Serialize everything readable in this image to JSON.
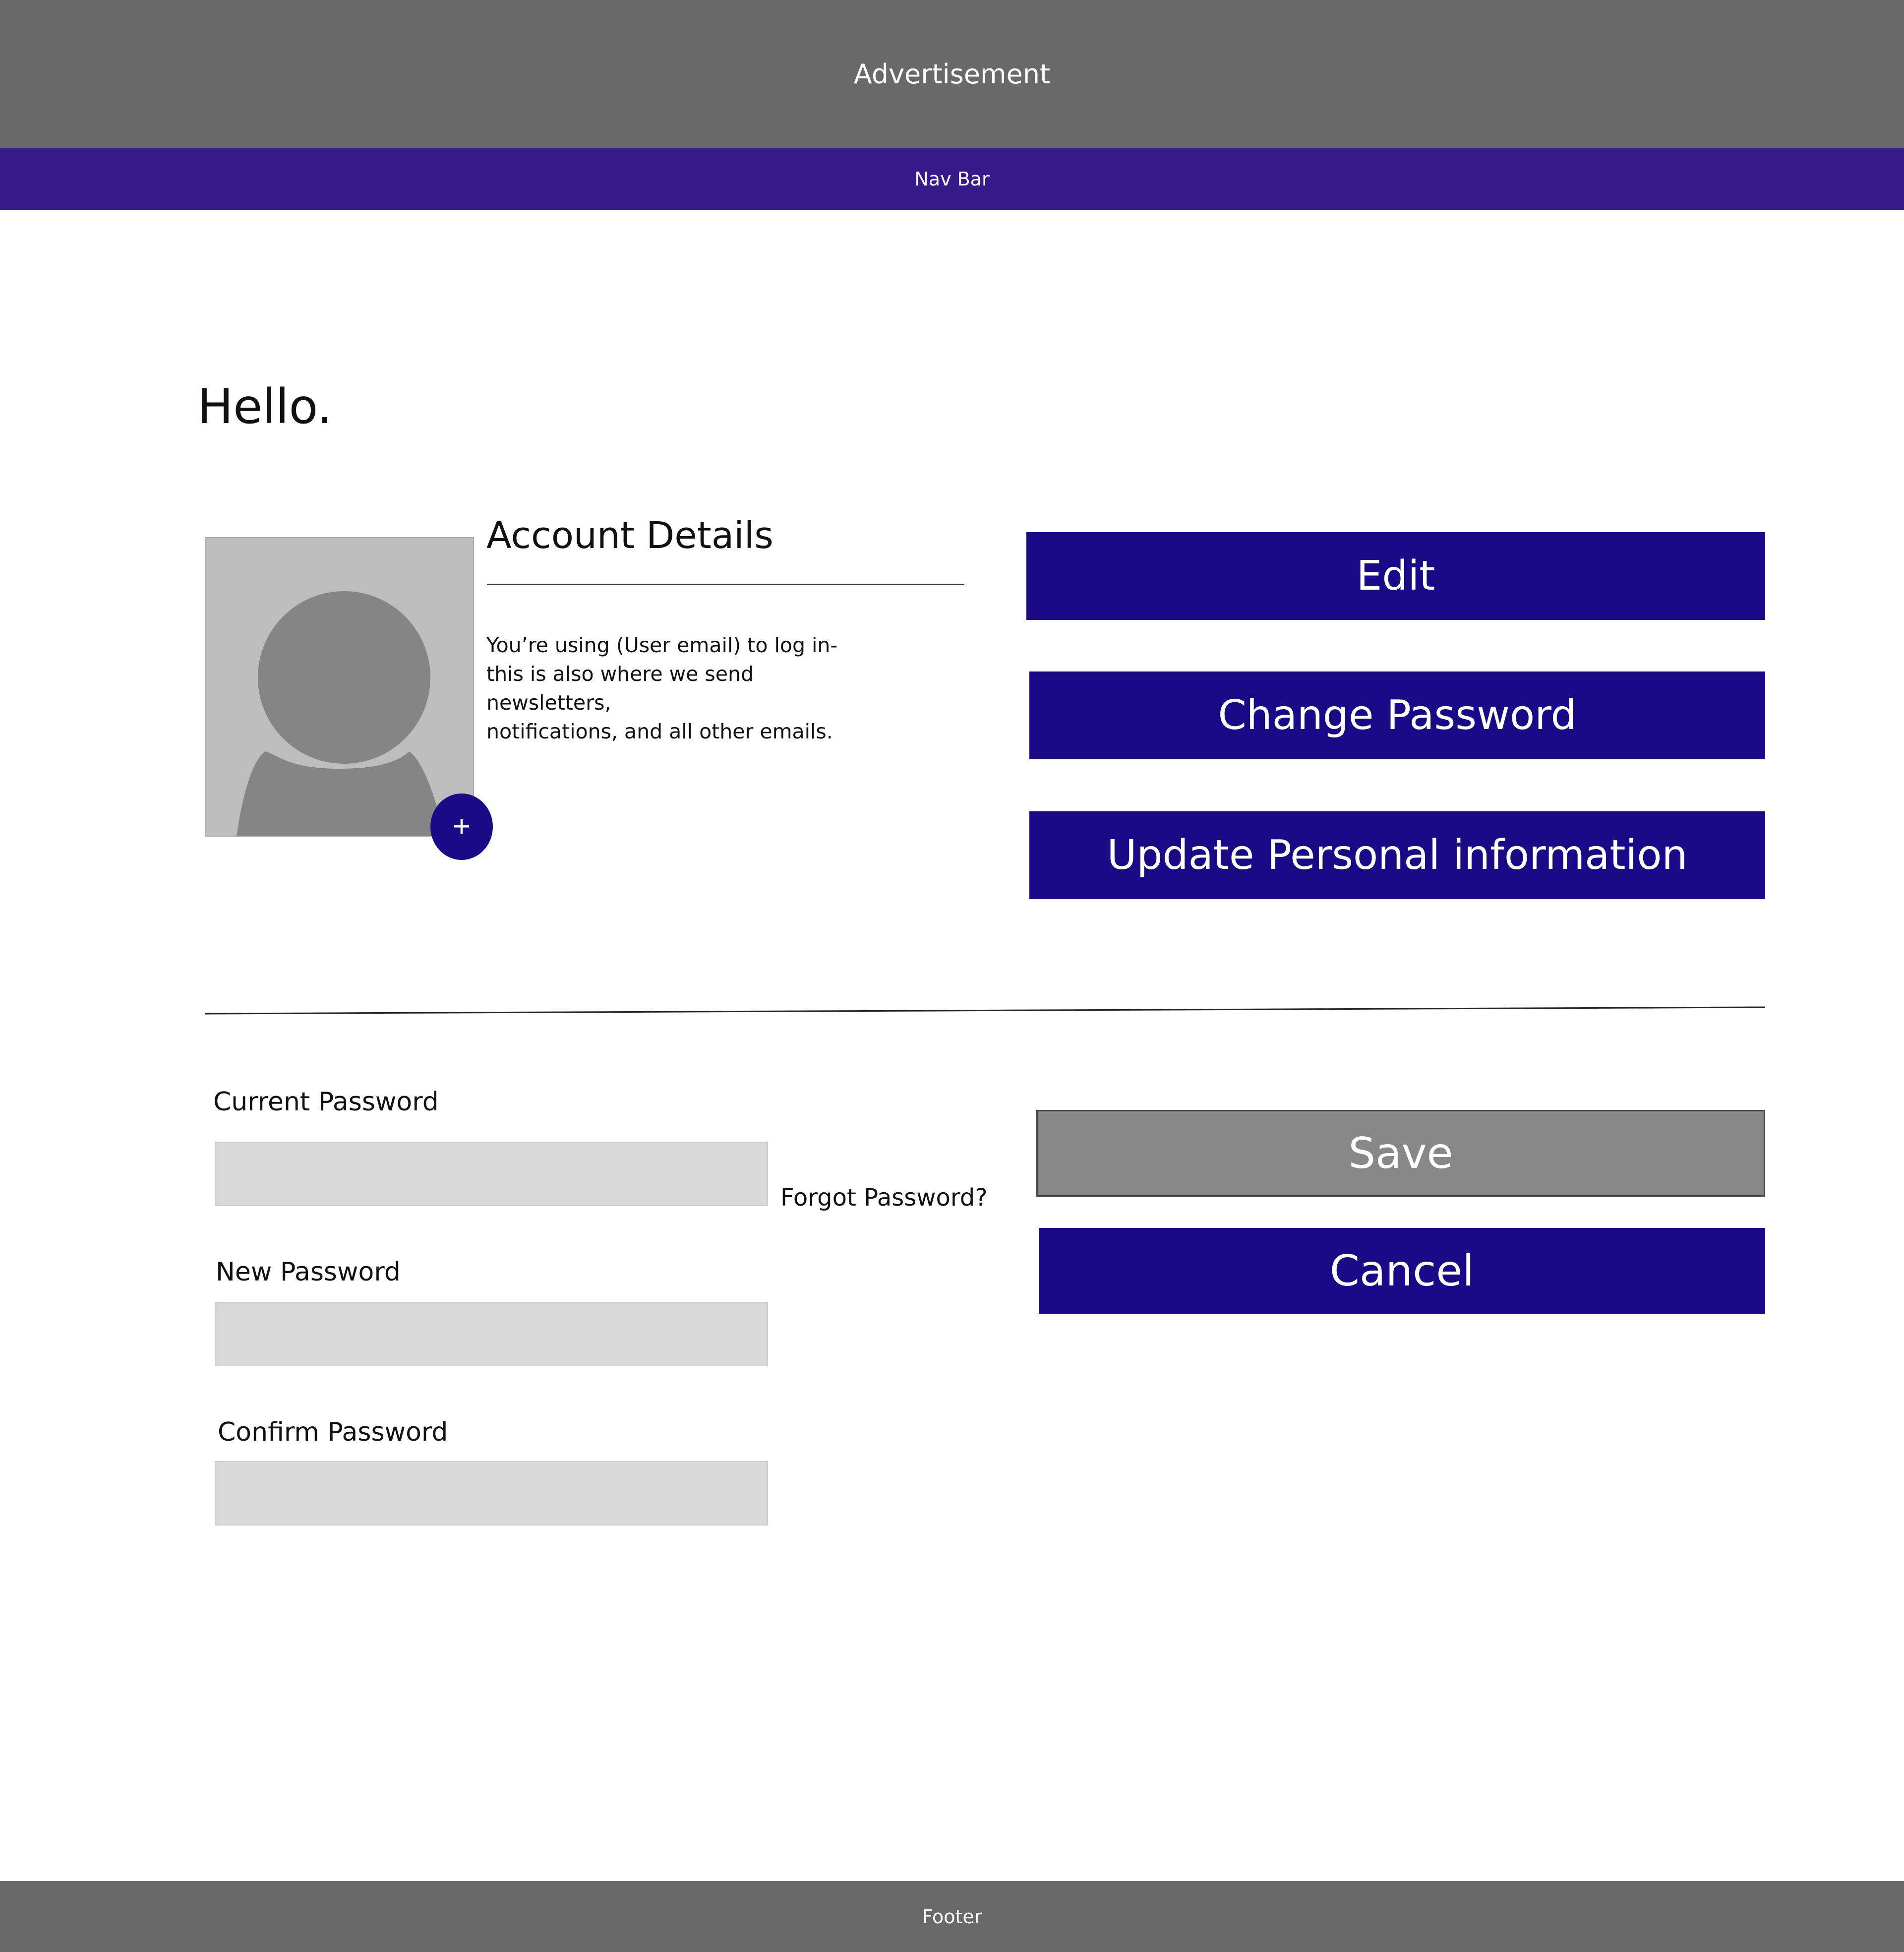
{
  "header": {
    "advertisement_label": "Advertisement",
    "nav_label": "Nav Bar"
  },
  "greeting": "Hello.",
  "account": {
    "title": "Account Details",
    "description": "You’re using (User email)  to log in-\nthis is also where we send newsletters,\nnotifications, and all other emails.",
    "add_photo_symbol": "+",
    "avatar_icon": "user-silhouette-icon"
  },
  "actions": {
    "edit": "Edit",
    "change_password": "Change Password",
    "update_info": "Update Personal information"
  },
  "password_form": {
    "current_label": "Current Password",
    "current_value": "",
    "new_label": "New Password",
    "new_value": "",
    "confirm_label": "Confirm Password",
    "confirm_value": "",
    "forgot_link": "Forgot Password?",
    "save": "Save",
    "cancel": "Cancel"
  },
  "footer": {
    "label": "Footer"
  },
  "colors": {
    "header_bg": "#696969",
    "nav_bg": "#371a8a",
    "primary_button": "#1b0a86",
    "save_button": "#888888",
    "input_bg": "#d9d9d9"
  }
}
